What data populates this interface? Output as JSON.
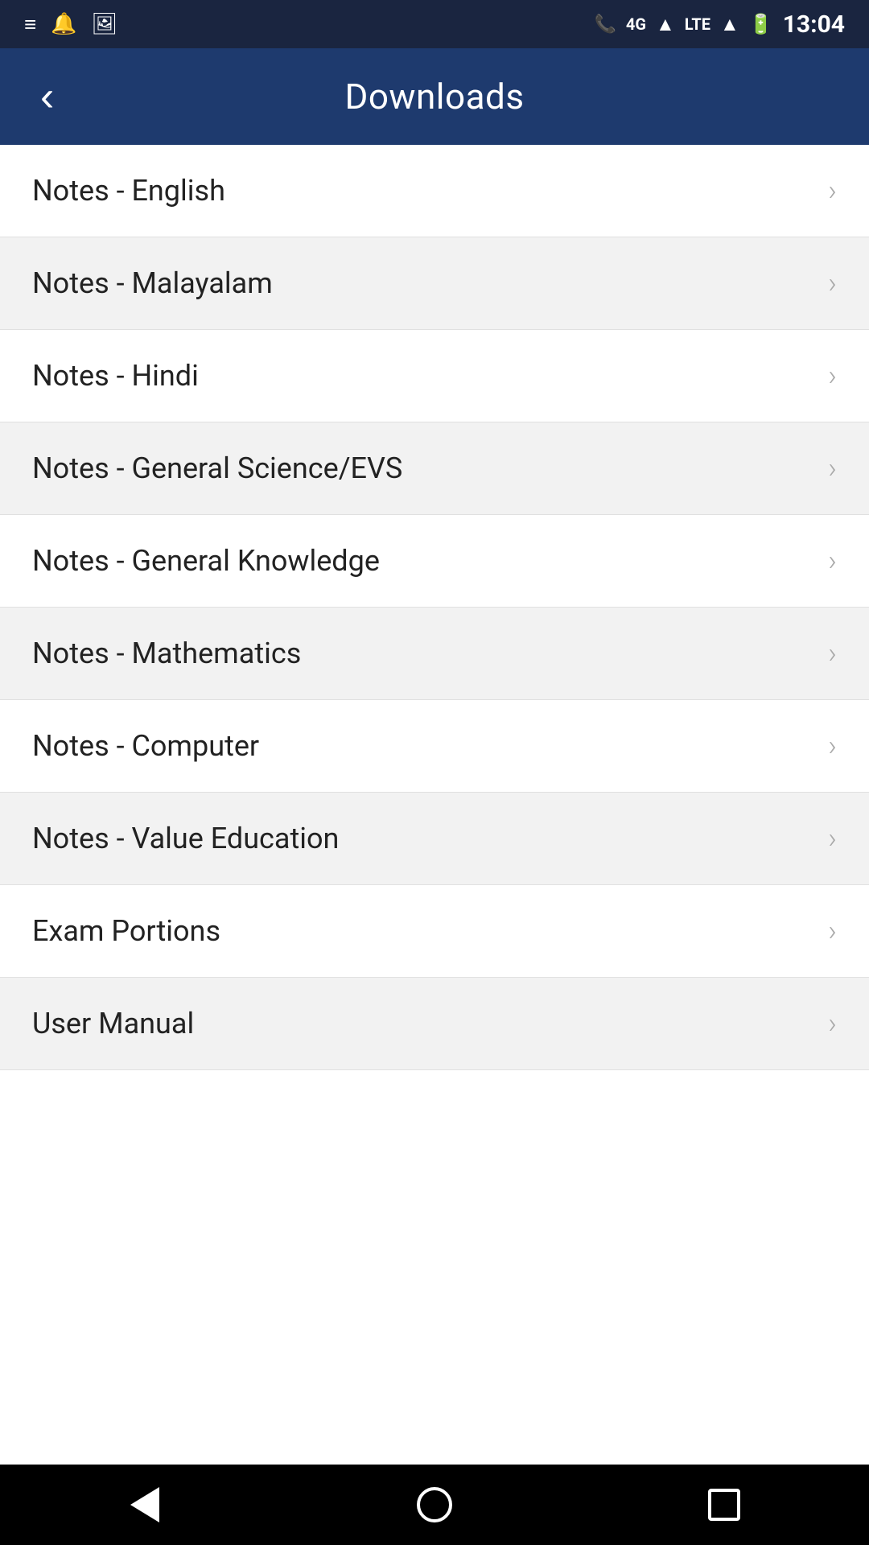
{
  "statusBar": {
    "time": "13:04",
    "icons": [
      "menu-icon",
      "notification-icon",
      "image-icon",
      "phone-icon",
      "signal-icon",
      "lte-icon",
      "signal2-icon",
      "battery-icon"
    ]
  },
  "header": {
    "title": "Downloads",
    "backLabel": "‹"
  },
  "listItems": [
    {
      "id": 1,
      "label": "Notes - English"
    },
    {
      "id": 2,
      "label": "Notes - Malayalam"
    },
    {
      "id": 3,
      "label": "Notes - Hindi"
    },
    {
      "id": 4,
      "label": "Notes - General Science/EVS"
    },
    {
      "id": 5,
      "label": "Notes - General Knowledge"
    },
    {
      "id": 6,
      "label": "Notes - Mathematics"
    },
    {
      "id": 7,
      "label": "Notes - Computer"
    },
    {
      "id": 8,
      "label": "Notes - Value Education"
    },
    {
      "id": 9,
      "label": "Exam Portions"
    },
    {
      "id": 10,
      "label": "User Manual"
    }
  ],
  "bottomNav": {
    "back": "back",
    "home": "home",
    "recent": "recent"
  }
}
